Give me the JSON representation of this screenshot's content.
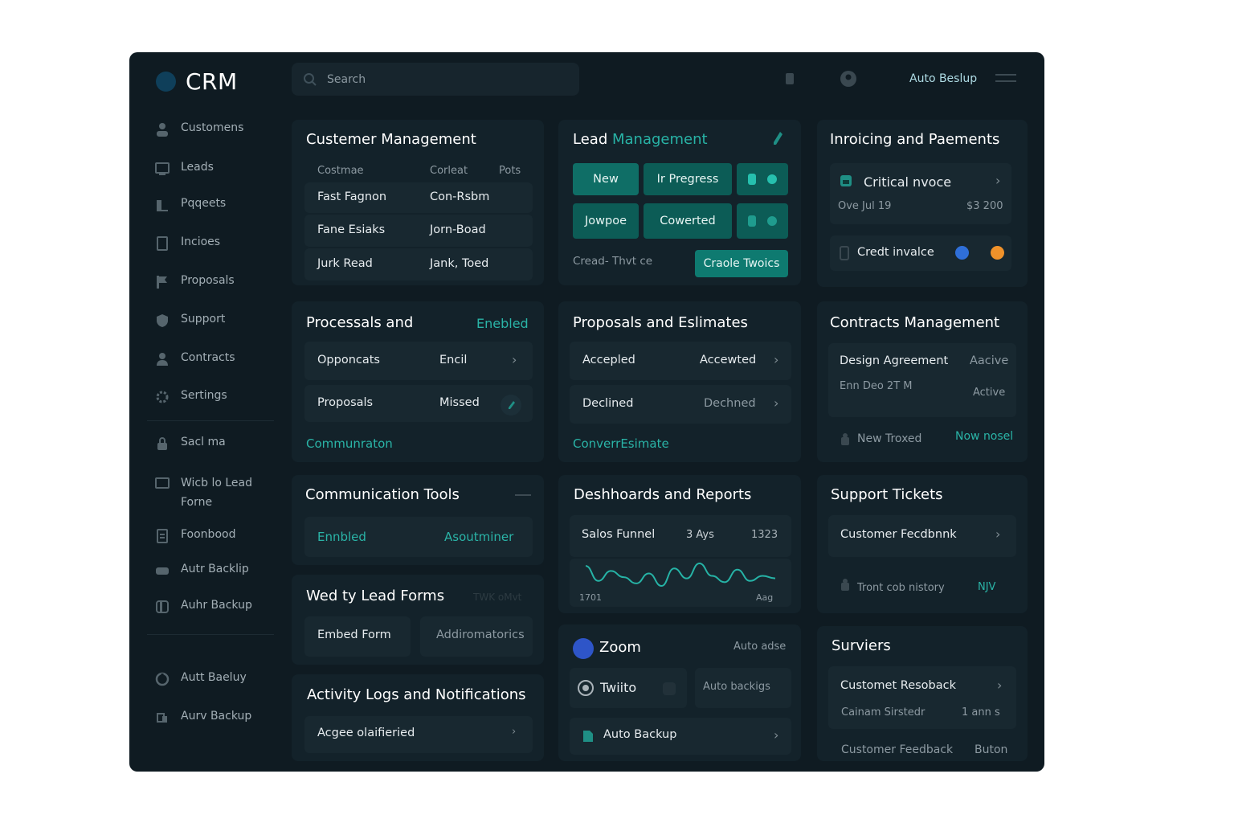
{
  "app": {
    "brand": "CRM",
    "search_placeholder": "Search",
    "top_link": "Auto Beslup"
  },
  "sidebar": {
    "items": [
      {
        "label": "Customens",
        "icon": "user-icon"
      },
      {
        "label": "Leads",
        "icon": "monitor-icon"
      },
      {
        "label": "Pqqeets",
        "icon": "folder-icon"
      },
      {
        "label": "Incioes",
        "icon": "document-icon"
      },
      {
        "label": "Proposals",
        "icon": "flag-icon"
      },
      {
        "label": "Support",
        "icon": "shield-icon"
      },
      {
        "label": "Contracts",
        "icon": "person-icon"
      },
      {
        "label": "Sertings",
        "icon": "gear-icon"
      },
      {
        "label": "Sacl ma",
        "icon": "lock-icon"
      },
      {
        "label": "Wicb lo Lead\nForne",
        "icon": "window-icon"
      },
      {
        "label": "Foonbood",
        "icon": "list-icon"
      },
      {
        "label": "Autr Backlip",
        "icon": "drive-icon"
      },
      {
        "label": "Auhr Backup",
        "icon": "database-icon"
      },
      {
        "label": "Autt Baeluy",
        "icon": "refresh-icon"
      },
      {
        "label": "Aurv Backup",
        "icon": "backup-icon"
      }
    ]
  },
  "customer_management": {
    "title": "Custemer Management",
    "headers": [
      "Costmae",
      "Corleat",
      "Pots"
    ],
    "rows": [
      [
        "Fast Fagnon",
        "Con-Rsbm"
      ],
      [
        "Fane Esiaks",
        "Jorn-Boad"
      ],
      [
        "Jurk Read",
        "Jank, Toed"
      ]
    ]
  },
  "lead_management": {
    "title_a": "Lead",
    "title_b": "Management",
    "buttons": [
      "New",
      "Ir Pregress",
      "Jowpoe",
      "Cowerted"
    ],
    "caption": "Cread- Thvt ce",
    "action": "Craole Twoics"
  },
  "invoicing": {
    "title": "Inroicing and Paements",
    "item1": "Critical nvoce",
    "item1_due": "Ove  Jul 19",
    "item1_amount": "$3 200",
    "item2": "Credt invalce",
    "dot_colors": [
      "#2f6fd8",
      "#f0922a"
    ]
  },
  "processals": {
    "title": "Processals and",
    "status": "Enebled",
    "rows": [
      [
        "Opponcats",
        "Encil"
      ],
      [
        "Proposals",
        "Missed"
      ]
    ],
    "link": "Communraton"
  },
  "proposals": {
    "title": "Proposals and Eslimates",
    "rows": [
      [
        "Accepled",
        "Accewted"
      ],
      [
        "Declined",
        "Dechned"
      ]
    ],
    "link": "ConverrEsimate"
  },
  "contracts": {
    "title": "Contracts Management",
    "item": "Design Agreement",
    "item_status": "Aacive",
    "item_date": "Enn Deo  2T M",
    "item_status2": "Active",
    "footer": "New Troxed",
    "footer_link": "Now nosel"
  },
  "communication": {
    "title": "Communication Tools",
    "left": "Ennbled",
    "right": "Asoutminer"
  },
  "web_lead_forms": {
    "title": "Wed ty Lead Forms",
    "faint": "TWK oMvt",
    "left": "Embed Form",
    "right": "Addiromatorics"
  },
  "activity": {
    "title": "Activity Logs and Notifications",
    "row": "Acgee olaifieried"
  },
  "dashboards": {
    "title": "Deshhoards and Reports",
    "row_label": "Salos Funnel",
    "row_mid": "3 Ays",
    "row_val": "1323",
    "chart_data": {
      "type": "line",
      "x_labels": [
        "1701",
        "Aag"
      ],
      "values": [
        22,
        10,
        18,
        13,
        8,
        16,
        6,
        20,
        12,
        24,
        14,
        9,
        19,
        10,
        14,
        12
      ]
    }
  },
  "integrations": {
    "zoom": "Zoom",
    "zoom_right": "Auto adse",
    "twitter": "Twiito",
    "twitter_right": "Auto backigs",
    "backup": "Auto Backup"
  },
  "support": {
    "title": "Support Tickets",
    "row1": "Customer Fecdbnnk",
    "row2": "Tront cob nistory",
    "row2_right": "NJV"
  },
  "surveys": {
    "title": "Surviers",
    "row1": "Customet Resoback",
    "row1_sub": "Cainam Sirstedr",
    "row1_sub_right": "1 ann s",
    "row2": "Customer Feedback",
    "row2_right": "Buton"
  }
}
